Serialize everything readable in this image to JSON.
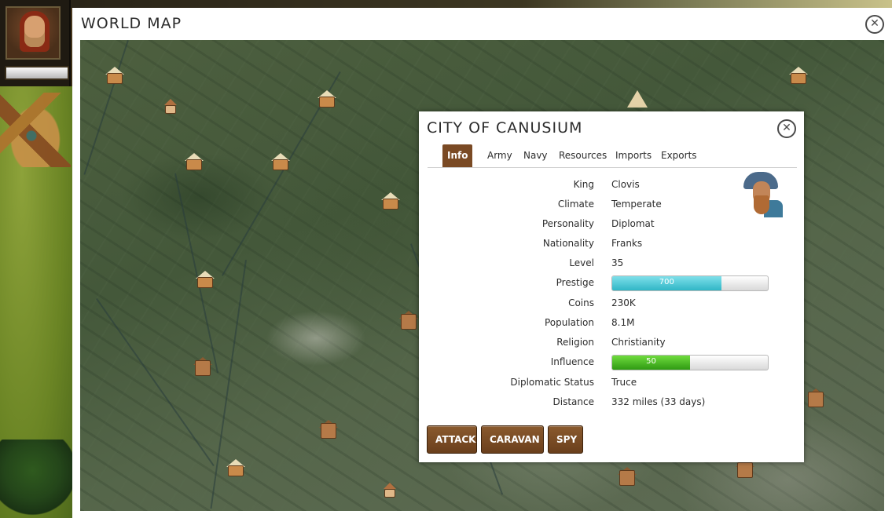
{
  "colors": {
    "tab_active": "#7a4a24",
    "button": "#6a3f1c",
    "prestige_bar": "#30b6c6",
    "influence_bar": "#2f9a12"
  },
  "hud": {
    "portrait_icon": "advisor-portrait-icon"
  },
  "world_map": {
    "title": "World Map",
    "title_display": "WORLD MAP",
    "close_icon": "close-icon"
  },
  "city": {
    "title": "City of Canusium",
    "title_display": "CITY OF CANUSIUM",
    "close_icon": "close-icon",
    "tabs": [
      {
        "label": "Info",
        "active": true
      },
      {
        "label": "Army",
        "active": false
      },
      {
        "label": "Navy",
        "active": false
      },
      {
        "label": "Resources",
        "active": false
      },
      {
        "label": "Imports",
        "active": false
      },
      {
        "label": "Exports",
        "active": false
      }
    ],
    "info": {
      "king": {
        "label": "King",
        "value": "Clovis"
      },
      "climate": {
        "label": "Climate",
        "value": "Temperate"
      },
      "personality": {
        "label": "Personality",
        "value": "Diplomat"
      },
      "nationality": {
        "label": "Nationality",
        "value": "Franks"
      },
      "level": {
        "label": "Level",
        "value": "35"
      },
      "prestige": {
        "label": "Prestige",
        "value": "700",
        "fill_fraction": 0.7
      },
      "coins": {
        "label": "Coins",
        "value": "230K"
      },
      "population": {
        "label": "Population",
        "value": "8.1M"
      },
      "religion": {
        "label": "Religion",
        "value": "Christianity"
      },
      "influence": {
        "label": "Influence",
        "value": "50",
        "fill_fraction": 0.5
      },
      "diplomatic_status": {
        "label": "Diplomatic Status",
        "value": "Truce"
      },
      "distance": {
        "label": "Distance",
        "value": "332 miles (33 days)"
      }
    },
    "actions": {
      "attack": "ATTACK",
      "caravan": "CARAVAN",
      "spy": "SPY"
    }
  }
}
